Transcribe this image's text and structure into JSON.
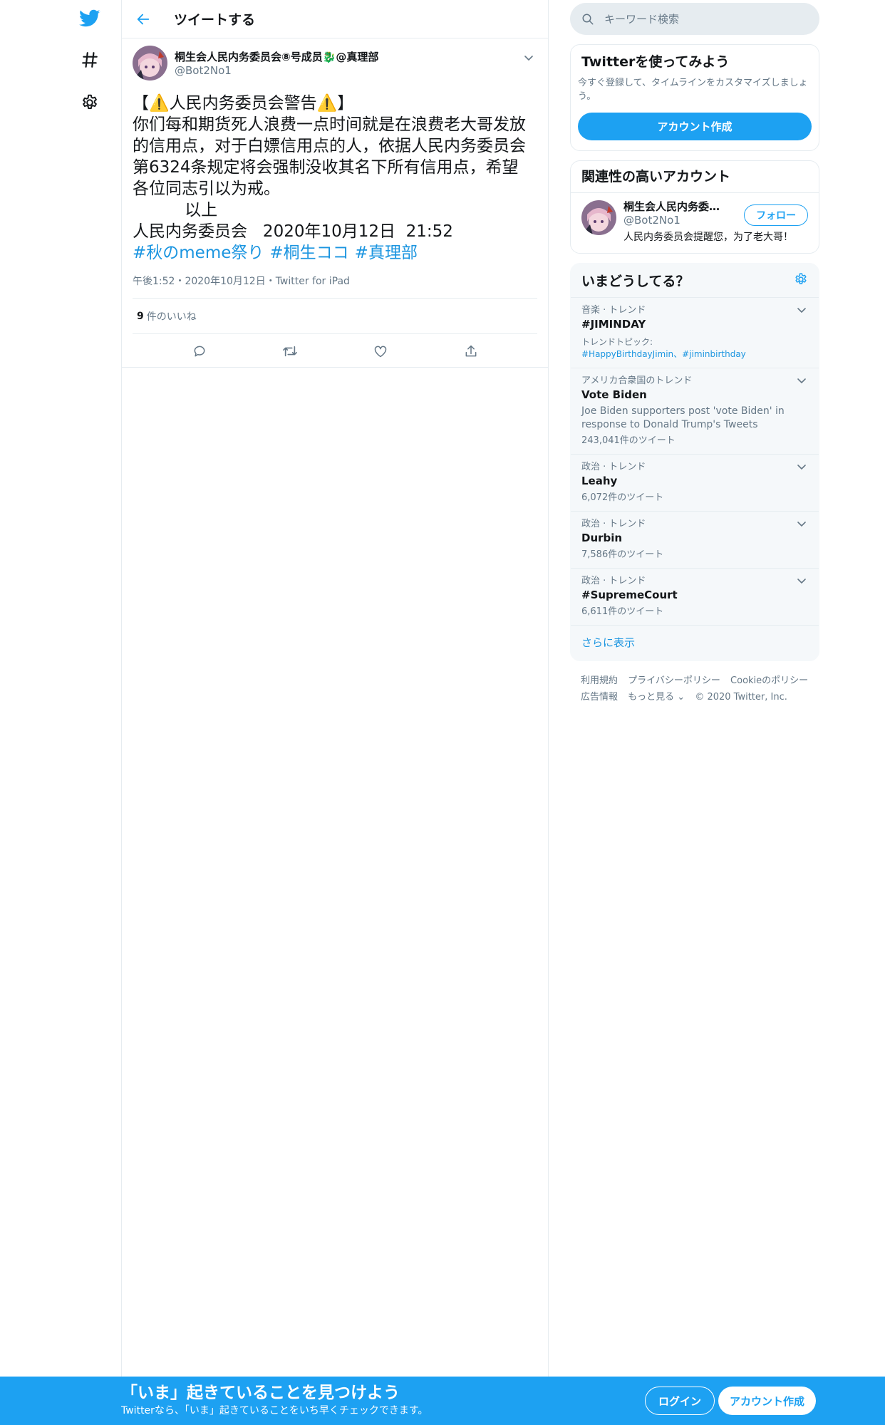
{
  "header": {
    "title": "ツイートする"
  },
  "tweet": {
    "author_name": "桐生会人民内务委员会⑧号成员🐉@真理部",
    "author_handle": "@Bot2No1",
    "body": "【⚠️人民内务委员会警告⚠️】\n你们每和期货死人浪费一点时间就是在浪费老大哥发放的信用点，对于白嫖信用点的人，依据人民内务委员会第6324条规定将会强制没收其名下所有信用点，希望各位同志引以为戒。\n          以上\n人民内务委员会   2020年10月12日  21:52",
    "hashtags": [
      "#秋のmeme祭り",
      "#桐生ココ",
      "#真理部"
    ],
    "meta": "午後1:52・2020年10月12日・Twitter for iPad",
    "likes_count": "9",
    "likes_label": "件のいいね"
  },
  "search": {
    "placeholder": "キーワード検索"
  },
  "signup_card": {
    "title": "Twitterを使ってみよう",
    "desc": "今すぐ登録して、タイムラインをカスタマイズしましょう。",
    "button": "アカウント作成"
  },
  "related": {
    "title": "関連性の高いアカウント",
    "name": "桐生会人民内务委员...",
    "handle": "@Bot2No1",
    "bio": "人民内务委员会提醒您，为了老大哥！",
    "follow": "フォロー"
  },
  "trends": {
    "title": "いまどうしてる？",
    "items": [
      {
        "context": "音楽 · トレンド",
        "name": "#JIMINDAY",
        "sub_label": "トレンドトピック:",
        "sub_links": "#HappyBirthdayJimin、#jiminbirthday"
      },
      {
        "context": "アメリカ合衆国のトレンド",
        "name": "Vote Biden",
        "desc": "Joe Biden supporters post 'vote Biden' in response to Donald Trump's Tweets",
        "count": "243,041件のツイート"
      },
      {
        "context": "政治 · トレンド",
        "name": "Leahy",
        "count": "6,072件のツイート"
      },
      {
        "context": "政治 · トレンド",
        "name": "Durbin",
        "count": "7,586件のツイート"
      },
      {
        "context": "政治 · トレンド",
        "name": "#SupremeCourt",
        "count": "6,611件のツイート"
      }
    ],
    "show_more": "さらに表示"
  },
  "footer": {
    "terms": "利用規約",
    "privacy": "プライバシーポリシー",
    "cookie": "Cookieのポリシー",
    "ads": "広告情報",
    "more": "もっと見る ⌄",
    "copyright": "© 2020 Twitter, Inc."
  },
  "bottom_bar": {
    "title": "「いま」起きていることを見つけよう",
    "subtitle": "Twitterなら、「いま」起きていることをいち早くチェックできます。",
    "login": "ログイン",
    "signup": "アカウント作成"
  },
  "colors": {
    "accent": "#1da1f2",
    "link": "#1b95e0",
    "muted": "#657786",
    "border": "#e6ecf0"
  }
}
